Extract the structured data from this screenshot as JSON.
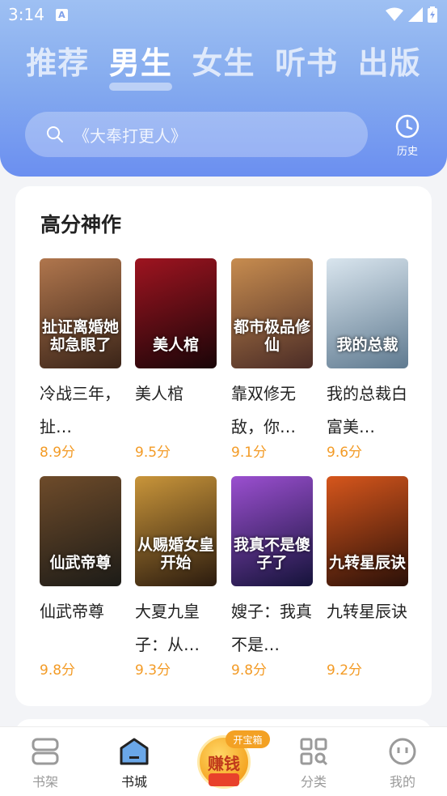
{
  "status_bar": {
    "time": "3:14",
    "app_badge": "A"
  },
  "tabs": [
    {
      "label": "推荐",
      "active": false
    },
    {
      "label": "男生",
      "active": true
    },
    {
      "label": "女生",
      "active": false
    },
    {
      "label": "听书",
      "active": false
    },
    {
      "label": "出版",
      "active": false
    }
  ],
  "search": {
    "placeholder": "《大奉打更人》"
  },
  "history": {
    "label": "历史"
  },
  "section": {
    "title": "高分神作",
    "books": [
      {
        "title": "冷战三年，扯…",
        "score": "8.9分",
        "cover_text": "扯证离婚她却急眼了",
        "cover_colors": [
          "#3a2418",
          "#b0764d"
        ]
      },
      {
        "title": "美人棺",
        "score": "9.5分",
        "cover_text": "美人棺",
        "cover_colors": [
          "#1a0508",
          "#9e1420"
        ]
      },
      {
        "title": "靠双修无敌，你…",
        "score": "9.1分",
        "cover_text": "都市极品修仙",
        "cover_colors": [
          "#4b2c26",
          "#c78c4f"
        ]
      },
      {
        "title": "我的总裁白富美…",
        "score": "9.6分",
        "cover_text": "我的总裁",
        "cover_colors": [
          "#5f7a90",
          "#d9e5ee"
        ]
      },
      {
        "title": "仙武帝尊",
        "score": "9.8分",
        "cover_text": "仙武帝尊",
        "cover_colors": [
          "#1c1b17",
          "#6e4b2a"
        ]
      },
      {
        "title": "大夏九皇子：从…",
        "score": "9.3分",
        "cover_text": "从赐婚女皇开始",
        "cover_colors": [
          "#2b1b0e",
          "#c9953a"
        ]
      },
      {
        "title": "嫂子：我真不是…",
        "score": "9.8分",
        "cover_text": "我真不是傻子了",
        "cover_colors": [
          "#15133a",
          "#9b4fd0"
        ]
      },
      {
        "title": "九转星辰诀",
        "score": "9.2分",
        "cover_text": "九转星辰诀",
        "cover_colors": [
          "#2a1008",
          "#d6561c"
        ]
      }
    ]
  },
  "bottom_nav": [
    {
      "label": "书架",
      "icon": "bookshelf-icon",
      "active": false
    },
    {
      "label": "书城",
      "icon": "bookstore-icon",
      "active": true
    },
    {
      "label": "赚钱",
      "icon": "earn-icon",
      "active": false,
      "badge": "开宝箱"
    },
    {
      "label": "分类",
      "icon": "category-icon",
      "active": false
    },
    {
      "label": "我的",
      "icon": "profile-icon",
      "active": false
    }
  ],
  "colors": {
    "accent": "#f39b26",
    "header": "#7e9ff0"
  }
}
